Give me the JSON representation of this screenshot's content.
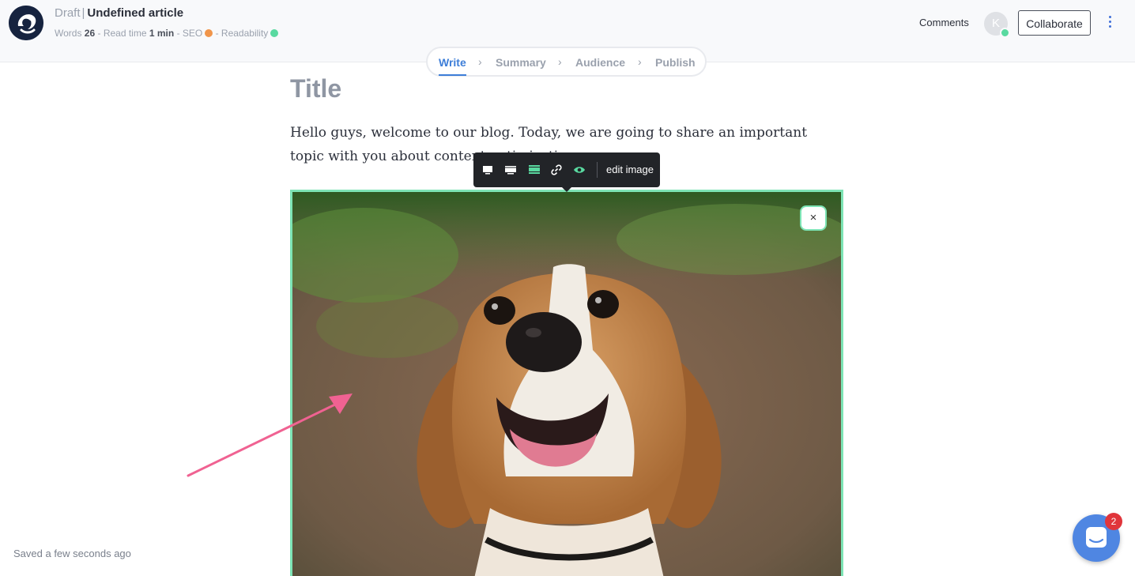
{
  "header": {
    "status": "Draft",
    "separator": "|",
    "title": "Undefined article",
    "words_label": "Words",
    "words_count": "26",
    "read_time_label": "- Read time",
    "read_time_value": "1 min",
    "seo_label": "- SEO",
    "seo_color": "#f0954a",
    "readability_label": "- Readability",
    "readability_color": "#59d9a0",
    "comments_label": "Comments",
    "avatar_initial": "K",
    "collaborate_label": "Collaborate"
  },
  "stepper": {
    "steps": [
      {
        "label": "Write",
        "active": true
      },
      {
        "label": "Summary",
        "active": false
      },
      {
        "label": "Audience",
        "active": false
      },
      {
        "label": "Publish",
        "active": false
      }
    ],
    "separator": "›"
  },
  "article": {
    "title_placeholder": "Title",
    "paragraph": "Hello guys, welcome to our blog. Today, we are going to share an important topic with you about content optimization."
  },
  "image_toolbar": {
    "icons": [
      "monitor-small-icon",
      "monitor-wide-icon",
      "monitor-full-icon",
      "link-icon",
      "eye-icon"
    ],
    "edit_label": "edit image",
    "active_color": "#59d9a0"
  },
  "image": {
    "alt": "Beagle dog close-up",
    "close_glyph": "×"
  },
  "footer": {
    "saved_text": "Saved a few seconds ago"
  },
  "chat": {
    "badge_count": "2"
  },
  "colors": {
    "accent": "#3d7ed8",
    "selection": "#7de4b5",
    "annotation_arrow": "#f06292"
  }
}
